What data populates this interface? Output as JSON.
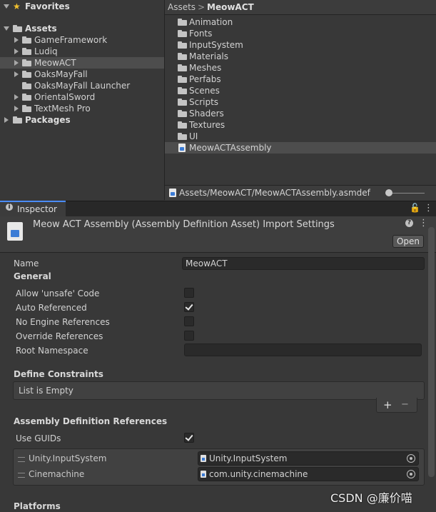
{
  "tree": {
    "favorites": "Favorites",
    "assets": "Assets",
    "items": [
      "GameFramework",
      "Ludiq",
      "MeowACT",
      "OaksMayFall",
      "OaksMayFall Launcher",
      "OrientalSword",
      "TextMesh Pro"
    ],
    "packages": "Packages"
  },
  "breadcrumb": {
    "root": "Assets",
    "separator": ">",
    "current": "MeowACT"
  },
  "files": [
    "Animation",
    "Fonts",
    "InputSystem",
    "Materials",
    "Meshes",
    "Perfabs",
    "Scenes",
    "Scripts",
    "Shaders",
    "Textures",
    "UI"
  ],
  "selected_file": "MeowACTAssembly",
  "path_bar": {
    "path": "Assets/MeowACT/MeowACTAssembly.asmdef"
  },
  "inspector": {
    "tab_label": "Inspector",
    "title": "Meow ACT Assembly (Assembly Definition Asset) Import Settings",
    "open_label": "Open",
    "name_label": "Name",
    "name_value": "MeowACT",
    "general": "General",
    "allow_unsafe": "Allow 'unsafe' Code",
    "auto_referenced": "Auto Referenced",
    "no_engine_refs": "No Engine References",
    "override_refs": "Override References",
    "root_namespace": "Root Namespace",
    "define_constraints": "Define Constraints",
    "list_empty": "List is Empty",
    "plus": "+",
    "minus": "−",
    "asm_refs": "Assembly Definition References",
    "use_guids": "Use GUIDs",
    "refs": [
      {
        "label": "Unity.InputSystem",
        "value": "Unity.InputSystem"
      },
      {
        "label": "Cinemachine",
        "value": "com.unity.cinemachine"
      }
    ],
    "platforms": "Platforms"
  },
  "watermark": "CSDN @廉价喵"
}
